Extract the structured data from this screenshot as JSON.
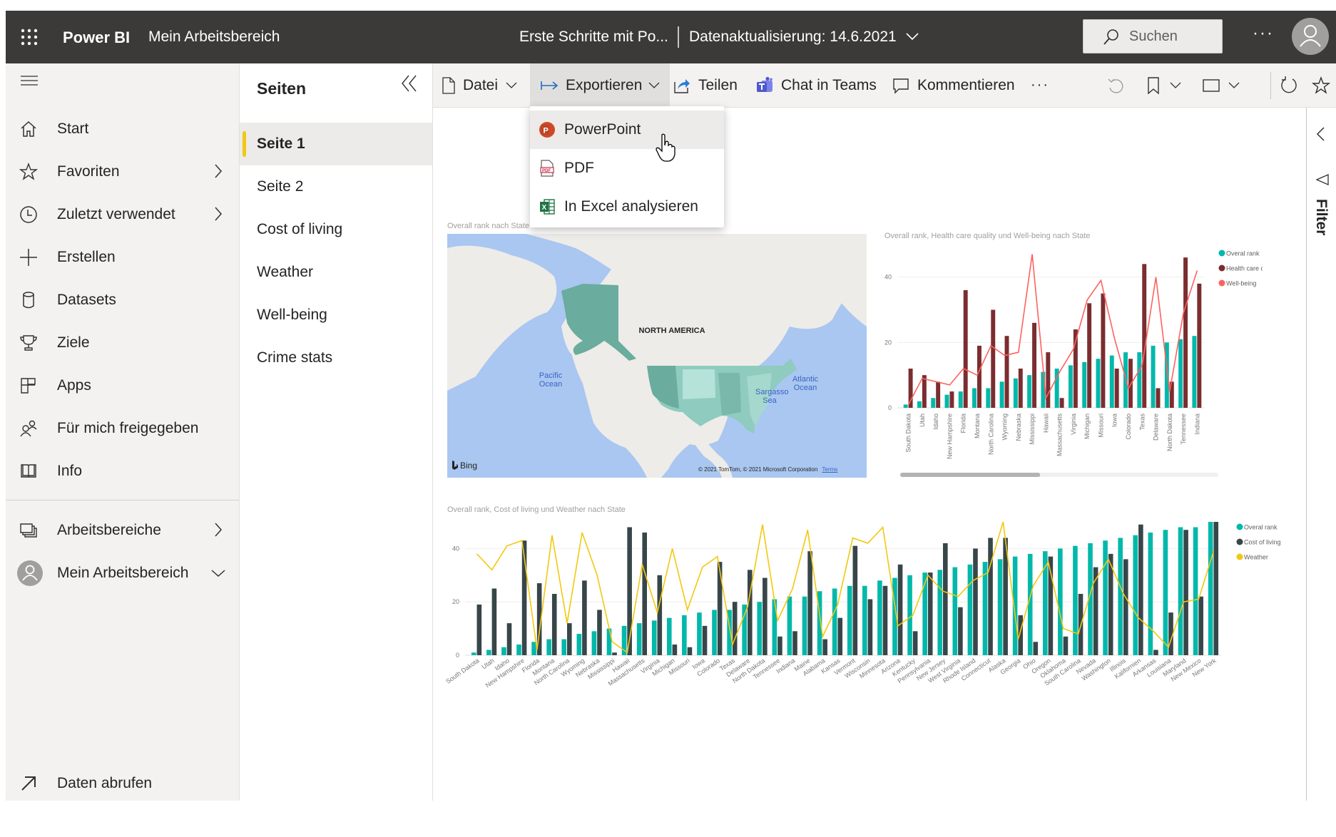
{
  "header": {
    "brand": "Power BI",
    "workspace": "Mein Arbeitsbereich",
    "report_title": "Erste Schritte mit Po...",
    "data_refresh": "Datenaktualisierung: 14.6.2021",
    "search_placeholder": "Suchen",
    "more": "···"
  },
  "leftnav": {
    "items": [
      {
        "label": "Start",
        "icon": "home-icon"
      },
      {
        "label": "Favoriten",
        "icon": "star-icon",
        "chevron": true
      },
      {
        "label": "Zuletzt verwendet",
        "icon": "clock-icon",
        "chevron": true
      },
      {
        "label": "Erstellen",
        "icon": "plus-icon"
      },
      {
        "label": "Datasets",
        "icon": "database-icon"
      },
      {
        "label": "Ziele",
        "icon": "trophy-icon"
      },
      {
        "label": "Apps",
        "icon": "apps-icon"
      },
      {
        "label": "Für mich freigegeben",
        "icon": "shared-people-icon"
      },
      {
        "label": "Info",
        "icon": "book-icon"
      }
    ],
    "workspaces": "Arbeitsbereiche",
    "my_workspace": "Mein Arbeitsbereich",
    "get_data": "Daten abrufen"
  },
  "pages": {
    "title": "Seiten",
    "items": [
      "Seite 1",
      "Seite 2",
      "Cost of living",
      "Weather",
      "Well-being",
      "Crime stats"
    ],
    "active": "Seite 1"
  },
  "toolbar": {
    "file": "Datei",
    "export": "Exportieren",
    "share": "Teilen",
    "teams": "Chat in Teams",
    "comment": "Kommentieren",
    "more": "···"
  },
  "export_menu": {
    "items": [
      {
        "label": "PowerPoint",
        "icon": "powerpoint-icon"
      },
      {
        "label": "PDF",
        "icon": "pdf-icon"
      },
      {
        "label": "In Excel analysieren",
        "icon": "excel-icon"
      }
    ],
    "hovered": "PowerPoint"
  },
  "filter_pane": {
    "label": "Filter"
  },
  "map": {
    "title": "Overall rank nach State",
    "labels": {
      "continent": "NORTH AMERICA",
      "pacific": "Pacific Ocean",
      "atlantic": "Atlantic Ocean",
      "sargasso": "Sargasso Sea"
    },
    "bing": "Bing",
    "copyright": "© 2021 TomTom, © 2021 Microsoft Corporation",
    "terms": "Terms"
  },
  "colors": {
    "teal": "#01b8aa",
    "maroon": "#7b2d2f",
    "dark": "#374649",
    "salmon": "#fd625e",
    "yellow": "#f2c80f",
    "accent_yellow": "#f2c811"
  },
  "chart_data": [
    {
      "type": "bar",
      "title": "Overall rank, Health care quality und Well-being nach State",
      "xlabel": "",
      "ylabel": "",
      "ylim": [
        0,
        48
      ],
      "yticks": [
        0,
        20,
        40
      ],
      "grid": true,
      "legend": "top-right",
      "categories": [
        "South Dakota",
        "Utah",
        "Idaho",
        "New Hampshire",
        "Florida",
        "Montana",
        "North Carolina",
        "Wyoming",
        "Nebraska",
        "Mississippi",
        "Hawaii",
        "Massachusetts",
        "Virginia",
        "Michigan",
        "Missouri",
        "Iowa",
        "Colorado",
        "Texas",
        "Delaware",
        "North Dakota",
        "Tennessee",
        "Indiana"
      ],
      "series": [
        {
          "name": "Overal rank",
          "kind": "bar",
          "color": "#01b8aa",
          "values": [
            1,
            2,
            3,
            4,
            5,
            6,
            6,
            8,
            9,
            10,
            11,
            12,
            13,
            14,
            15,
            16,
            17,
            17,
            19,
            20,
            21,
            22
          ]
        },
        {
          "name": "Health care quality",
          "kind": "bar",
          "color": "#7b2d2f",
          "values": [
            12,
            10,
            8,
            5,
            36,
            19,
            30,
            22,
            12,
            26,
            17,
            3,
            24,
            32,
            35,
            12,
            15,
            44,
            6,
            8,
            46,
            38
          ]
        },
        {
          "name": "Well-being",
          "kind": "line",
          "color": "#fd625e",
          "values": [
            1,
            9,
            8,
            7,
            12,
            10,
            19,
            16,
            17,
            47,
            3,
            11,
            18,
            33,
            39,
            21,
            6,
            13,
            40,
            5,
            29,
            42
          ]
        }
      ],
      "scrollbar_fraction": 0.44
    },
    {
      "type": "bar",
      "title": "Overall rank, Cost of living und Weather nach State",
      "xlabel": "",
      "ylabel": "",
      "ylim": [
        0,
        50
      ],
      "yticks": [
        0,
        20,
        40
      ],
      "grid": true,
      "legend": "top-right",
      "categories": [
        "South Dakota",
        "Utah",
        "Idaho",
        "New Hampshire",
        "Florida",
        "Montana",
        "North Carolina",
        "Wyoming",
        "Nebraska",
        "Mississippi",
        "Hawaii",
        "Massachusetts",
        "Virginia",
        "Michigan",
        "Missouri",
        "Iowa",
        "Colorado",
        "Texas",
        "Delaware",
        "North Dakota",
        "Tennessee",
        "Indiana",
        "Maine",
        "Alabama",
        "Kansas",
        "Vermont",
        "Wisconsin",
        "Minnesota",
        "Arizona",
        "Kentucky",
        "Pennsylvania",
        "New Jersey",
        "West Virginia",
        "Rhode Island",
        "Connecticut",
        "Alaska",
        "Georgia",
        "Ohio",
        "Oregon",
        "Oklahoma",
        "South Carolina",
        "Nevada",
        "Washington",
        "Illinois",
        "Kalifornien",
        "Arkansas",
        "Louisiana",
        "Maryland",
        "New Mexico",
        "New York"
      ],
      "series": [
        {
          "name": "Overal rank",
          "kind": "bar",
          "color": "#01b8aa",
          "values": [
            1,
            2,
            3,
            4,
            5,
            6,
            6,
            8,
            9,
            10,
            11,
            12,
            13,
            14,
            15,
            16,
            17,
            17,
            19,
            20,
            21,
            22,
            22,
            24,
            25,
            26,
            26,
            28,
            29,
            30,
            31,
            32,
            33,
            34,
            35,
            36,
            37,
            38,
            39,
            40,
            41,
            42,
            43,
            44,
            45,
            46,
            47,
            48,
            48,
            50
          ]
        },
        {
          "name": "Cost of living",
          "kind": "bar",
          "color": "#374649",
          "values": [
            19,
            25,
            12,
            43,
            27,
            23,
            12,
            28,
            17,
            1,
            48,
            46,
            30,
            4,
            3,
            11,
            35,
            20,
            32,
            29,
            7,
            9,
            39,
            6,
            14,
            41,
            21,
            26,
            34,
            9,
            31,
            42,
            18,
            40,
            44,
            44,
            15,
            5,
            37,
            7,
            23,
            33,
            38,
            36,
            49,
            2,
            16,
            47,
            22,
            50
          ]
        },
        {
          "name": "Weather",
          "kind": "line",
          "color": "#f2c80f",
          "values": [
            38,
            32,
            41,
            43,
            2,
            45,
            12,
            46,
            30,
            5,
            1,
            34,
            16,
            40,
            17,
            33,
            37,
            4,
            18,
            49,
            13,
            25,
            47,
            7,
            19,
            44,
            42,
            48,
            11,
            15,
            30,
            24,
            22,
            28,
            31,
            50,
            6,
            26,
            35,
            10,
            8,
            27,
            36,
            23,
            14,
            9,
            3,
            20,
            21,
            39
          ]
        }
      ]
    }
  ]
}
